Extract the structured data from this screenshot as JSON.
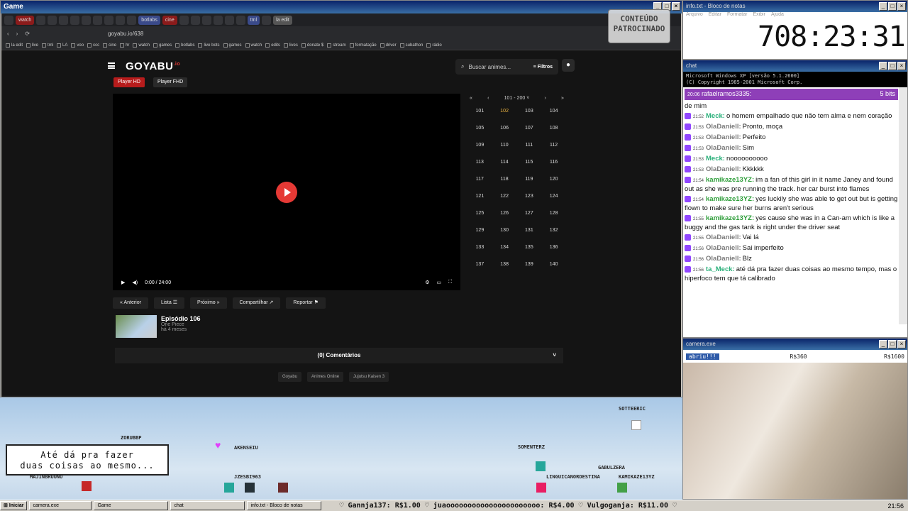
{
  "game_window": {
    "title": "Game",
    "browser": {
      "tabs": [
        "watch",
        "botlabs",
        "cine",
        "tml",
        "la edit"
      ],
      "url": "goyabu.io/638",
      "bookmarks": [
        "la edit",
        "live",
        "tml",
        "LA",
        "voo",
        "ccc",
        "cine",
        "hr",
        "watch",
        "games",
        "botlabs",
        "live bots",
        "games",
        "watch",
        "edits",
        "lives",
        "donate $",
        "stream",
        "formatação",
        "driver",
        "subathon",
        "rádio"
      ]
    },
    "overlay_badge": "CONTEÚDO PATROCINADO",
    "site": {
      "logo": "GOYABU",
      "logo_suffix": ".io",
      "search_placeholder": "Buscar animes...",
      "filters_label": "Filtros",
      "player_tabs": [
        "Player HD",
        "Player FHD"
      ],
      "video_time": "0:00 / 24:00",
      "range_label": "101 - 200",
      "episodes": [
        "101",
        "102",
        "103",
        "104",
        "105",
        "106",
        "107",
        "108",
        "109",
        "110",
        "111",
        "112",
        "113",
        "114",
        "115",
        "116",
        "117",
        "118",
        "119",
        "120",
        "121",
        "122",
        "123",
        "124",
        "125",
        "126",
        "127",
        "128",
        "129",
        "130",
        "131",
        "132",
        "133",
        "134",
        "135",
        "136",
        "137",
        "138",
        "139",
        "140"
      ],
      "active_episode": "102",
      "actions": [
        "Anterior",
        "Lista",
        "Próximo",
        "Compartilhar",
        "Reportar"
      ],
      "episode_title": "Episódio 106",
      "series_name": "One Piece",
      "episode_age": "há 4 meses",
      "comments_label": "(0) Comentários",
      "footer_links": [
        "Goyabu",
        "Animes Online",
        "Jujutsu Kaisen 3"
      ]
    }
  },
  "scene": {
    "speech_line1": "Até dá pra fazer",
    "speech_line2": "duas coisas ao mesmo...",
    "nicks": [
      "ZORUBBP",
      "AKENSEIU",
      "JZESBI963",
      "MAJINBRUUNO",
      "SOMENTERZ",
      "GABULZERA",
      "LINGUICANORDESTINA",
      "KAMIKAZE13YZ",
      "SOTTEERIC"
    ]
  },
  "timer_window": {
    "title": "info.txt - Bloco de notas",
    "menu": [
      "Arquivo",
      "Editar",
      "Formatar",
      "Exibir",
      "Ajuda"
    ],
    "timer": "708:23:31"
  },
  "chat_window": {
    "title": "chat",
    "cmd_line1": "Microsoft Windows XP [versão 5.1.2600]",
    "cmd_line2": "(C) Copyright 1985-2001 Microsoft Corp.",
    "bits_time": "20:06",
    "bits_user": "rafaelramos3335:",
    "bits_amount": "5 bits",
    "messages": [
      {
        "time": "",
        "user": "",
        "text": "de mim",
        "color": "#111111"
      },
      {
        "time": "21:52",
        "user": "Meck:",
        "text": "o homem empalhado que não tem alma e nem coração",
        "color": "#2ab07a"
      },
      {
        "time": "21:53",
        "user": "OlaDaniell:",
        "text": "Pronto, moça",
        "color": "#7a7a7a"
      },
      {
        "time": "21:53",
        "user": "OlaDaniell:",
        "text": "Perfeito",
        "color": "#7a7a7a"
      },
      {
        "time": "21:53",
        "user": "OlaDaniell:",
        "text": "Sim",
        "color": "#7a7a7a"
      },
      {
        "time": "21:53",
        "user": "Meck:",
        "text": "noooooooooo",
        "color": "#2ab07a"
      },
      {
        "time": "21:53",
        "user": "OlaDaniell:",
        "text": "Kkkkkk",
        "color": "#7a7a7a"
      },
      {
        "time": "21:54",
        "user": "kamikaze13YZ:",
        "text": "im a fan of this girl in it name Janey and found out as she was pre running the track. her car burst into flames",
        "color": "#2e9e3a"
      },
      {
        "time": "21:54",
        "user": "kamikaze13YZ:",
        "text": "yes luckily she was able to get out but is getting flown to make sure her burns aren't serious",
        "color": "#2e9e3a"
      },
      {
        "time": "21:55",
        "user": "kamikaze13YZ:",
        "text": "yes cause she was in a Can-am which is like a buggy and the gas tank is right under the driver seat",
        "color": "#2e9e3a"
      },
      {
        "time": "21:55",
        "user": "OlaDaniell:",
        "text": "Vai lá",
        "color": "#7a7a7a"
      },
      {
        "time": "21:56",
        "user": "OlaDaniell:",
        "text": "Sai imperfeito",
        "color": "#7a7a7a"
      },
      {
        "time": "21:56",
        "user": "OlaDaniell:",
        "text": "Blz",
        "color": "#7a7a7a"
      },
      {
        "time": "21:56",
        "user": "ta_Meck:",
        "text": "até dá pra fazer duas coisas ao mesmo tempo, mas o hiperfoco tem que tá calibrado",
        "color": "#2ab07a"
      }
    ]
  },
  "cam_window": {
    "title": "camera.exe",
    "goal_text": "abriu!!!",
    "goal_mid": "R$360",
    "goal_end": "R$1600"
  },
  "taskbar": {
    "start": "Iniciar",
    "items": [
      "camera.exe",
      "Game",
      "chat",
      "info.txt - Bloco de notas"
    ],
    "ticker": "♡ Gannja137: R$1.00   ♡ juaoooooooooooooooooooooo: R$4.00   ♡ Vulgoganja: R$11.00   ♡",
    "clock": "21:56"
  }
}
